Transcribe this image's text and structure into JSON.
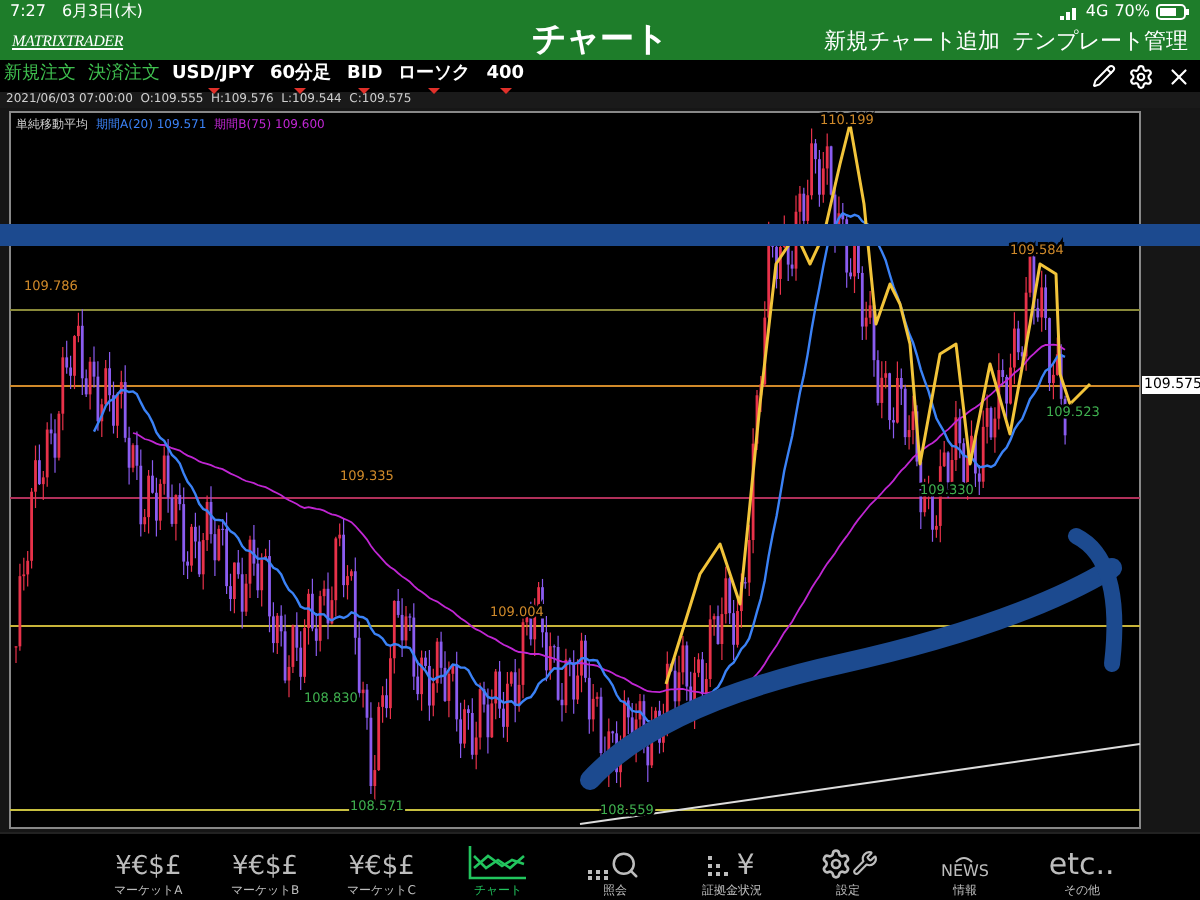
{
  "status_bar": {
    "time": "7:27",
    "date": "6月3日(木)",
    "network": "4G",
    "battery": "70%"
  },
  "header": {
    "logo": "MATRIXTRADER",
    "title": "チャート",
    "actions": [
      "新規チャート追加",
      "テンプレート管理"
    ]
  },
  "toolbar": {
    "order_buttons": [
      "新規注文",
      "決済注文"
    ],
    "selectors": [
      "USD/JPY",
      "60分足",
      "BID",
      "ローソク",
      "400"
    ]
  },
  "ohlc": "2021/06/03 07:00:00  O:109.555  H:109.576  L:109.544  C:109.575",
  "chart": {
    "legend": {
      "title": "単純移動平均",
      "series": [
        {
          "label": "期間A(20)",
          "value": "109.571",
          "color": "#3b82f6"
        },
        {
          "label": "期間B(75)",
          "value": "109.600",
          "color": "#c026d3"
        }
      ]
    },
    "price_labels": [
      {
        "text": "110.199",
        "kind": "high"
      },
      {
        "text": "109.584",
        "kind": "high"
      },
      {
        "text": "109.786",
        "kind": "high"
      },
      {
        "text": "109.335",
        "kind": "high"
      },
      {
        "text": "109.004",
        "kind": "high"
      },
      {
        "text": "108.830",
        "kind": "low"
      },
      {
        "text": "108.571",
        "kind": "low"
      },
      {
        "text": "108.559",
        "kind": "low"
      },
      {
        "text": "109.330",
        "kind": "low"
      },
      {
        "text": "109.523",
        "kind": "low"
      }
    ],
    "current_price": "109.575"
  },
  "bottom_nav": [
    {
      "kind": "currency",
      "icon_text": "¥€$£",
      "label": "マーケットA",
      "selected": false
    },
    {
      "kind": "currency",
      "icon_text": "¥€$£",
      "label": "マーケットB",
      "selected": false
    },
    {
      "kind": "currency",
      "icon_text": "¥€$£",
      "label": "マーケットC",
      "selected": false
    },
    {
      "kind": "chart",
      "label": "チャート",
      "selected": true
    },
    {
      "kind": "search",
      "label": "照会",
      "selected": false
    },
    {
      "kind": "margin",
      "icon_text": "¥",
      "label": "証拠金状況",
      "selected": false
    },
    {
      "kind": "settings",
      "label": "設定",
      "selected": false
    },
    {
      "kind": "news",
      "icon_text": "NEWS",
      "label": "情報",
      "selected": false
    },
    {
      "kind": "etc",
      "icon_text": "etc..",
      "label": "その他",
      "selected": false
    }
  ]
}
